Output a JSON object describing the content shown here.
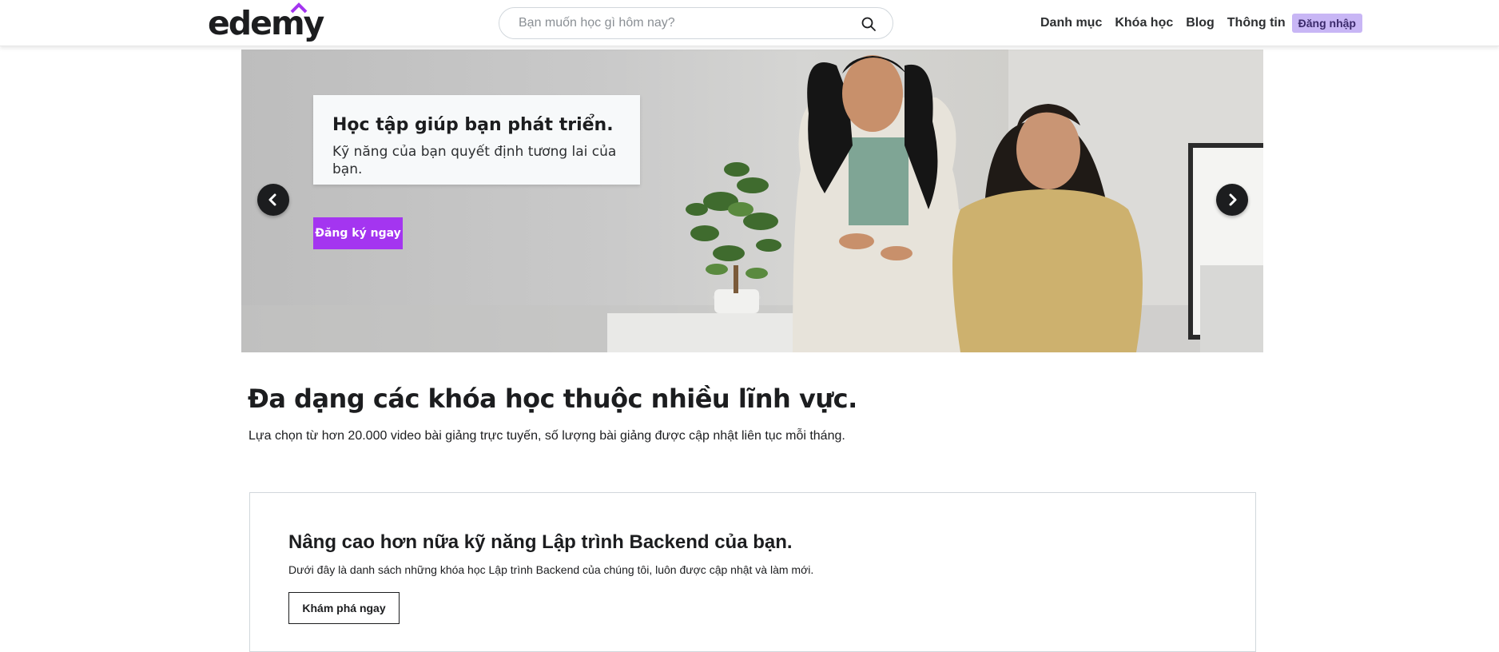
{
  "header": {
    "logo_text": "edemy",
    "search": {
      "placeholder": "Bạn muốn học gì hôm nay?",
      "value": ""
    },
    "nav": [
      {
        "label": "Danh mục"
      },
      {
        "label": "Khóa học"
      },
      {
        "label": "Blog"
      },
      {
        "label": "Thông tin"
      }
    ],
    "login_label": "Đăng nhập"
  },
  "hero": {
    "title": "Học tập giúp bạn phát triển.",
    "subtitle": "Kỹ năng của bạn quyết định tương lai của bạn.",
    "cta_label": "Đăng ký ngay"
  },
  "section": {
    "title": "Đa dạng các khóa học thuộc nhiều lĩnh vực.",
    "description": "Lựa chọn từ hơn 20.000 video bài giảng trực tuyến, số lượng bài giảng được cập nhật liên tục mỗi tháng."
  },
  "category": {
    "title": "Nâng cao hơn nữa kỹ năng Lập trình Backend của bạn.",
    "description": "Dưới đây là danh sách những khóa học Lập trình Backend của chúng tôi, luôn được cập nhật và làm mới.",
    "button_label": "Khám phá ngay"
  },
  "colors": {
    "brand_purple": "#a435f0",
    "login_bg": "#c8b6f5",
    "text_dark": "#1c1d1f"
  },
  "icons": {
    "search": "search-icon",
    "prev": "chevron-left-icon",
    "next": "chevron-right-icon"
  }
}
